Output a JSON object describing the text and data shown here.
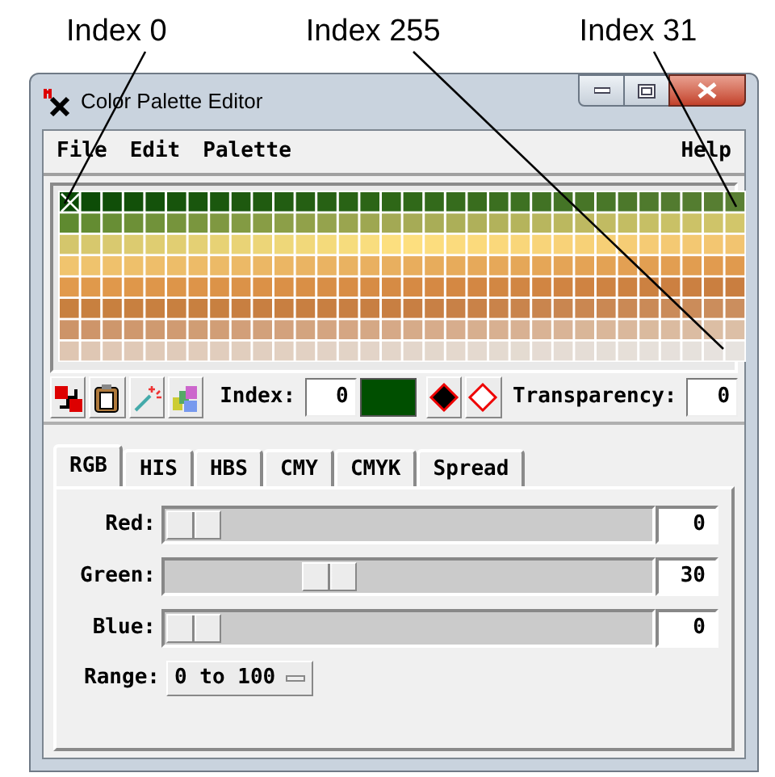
{
  "annotations": [
    {
      "label": "Index 0"
    },
    {
      "label": "Index 255"
    },
    {
      "label": "Index 31"
    }
  ],
  "window": {
    "title": "Color Palette Editor"
  },
  "menu": [
    {
      "label": "File"
    },
    {
      "label": "Edit"
    },
    {
      "label": "Palette"
    },
    {
      "label": "Help"
    }
  ],
  "toolbar": {
    "index_label": "Index:",
    "index_value": "0",
    "color": "#004f00",
    "transparency_label": "Transparency:",
    "transparency_value": "0"
  },
  "tabs": [
    {
      "label": "RGB",
      "selected": true
    },
    {
      "label": "HIS",
      "selected": false
    },
    {
      "label": "HBS",
      "selected": false
    },
    {
      "label": "CMY",
      "selected": false
    },
    {
      "label": "CMYK",
      "selected": false
    },
    {
      "label": "Spread",
      "selected": false
    }
  ],
  "sliders": [
    {
      "label": "Red:",
      "level": 0,
      "value": "0"
    },
    {
      "label": "Green:",
      "level": 0.3,
      "value": "30"
    },
    {
      "label": "Blue:",
      "level": 0,
      "value": "0"
    }
  ],
  "range": {
    "label": "Range:",
    "value": "0 to 100"
  }
}
